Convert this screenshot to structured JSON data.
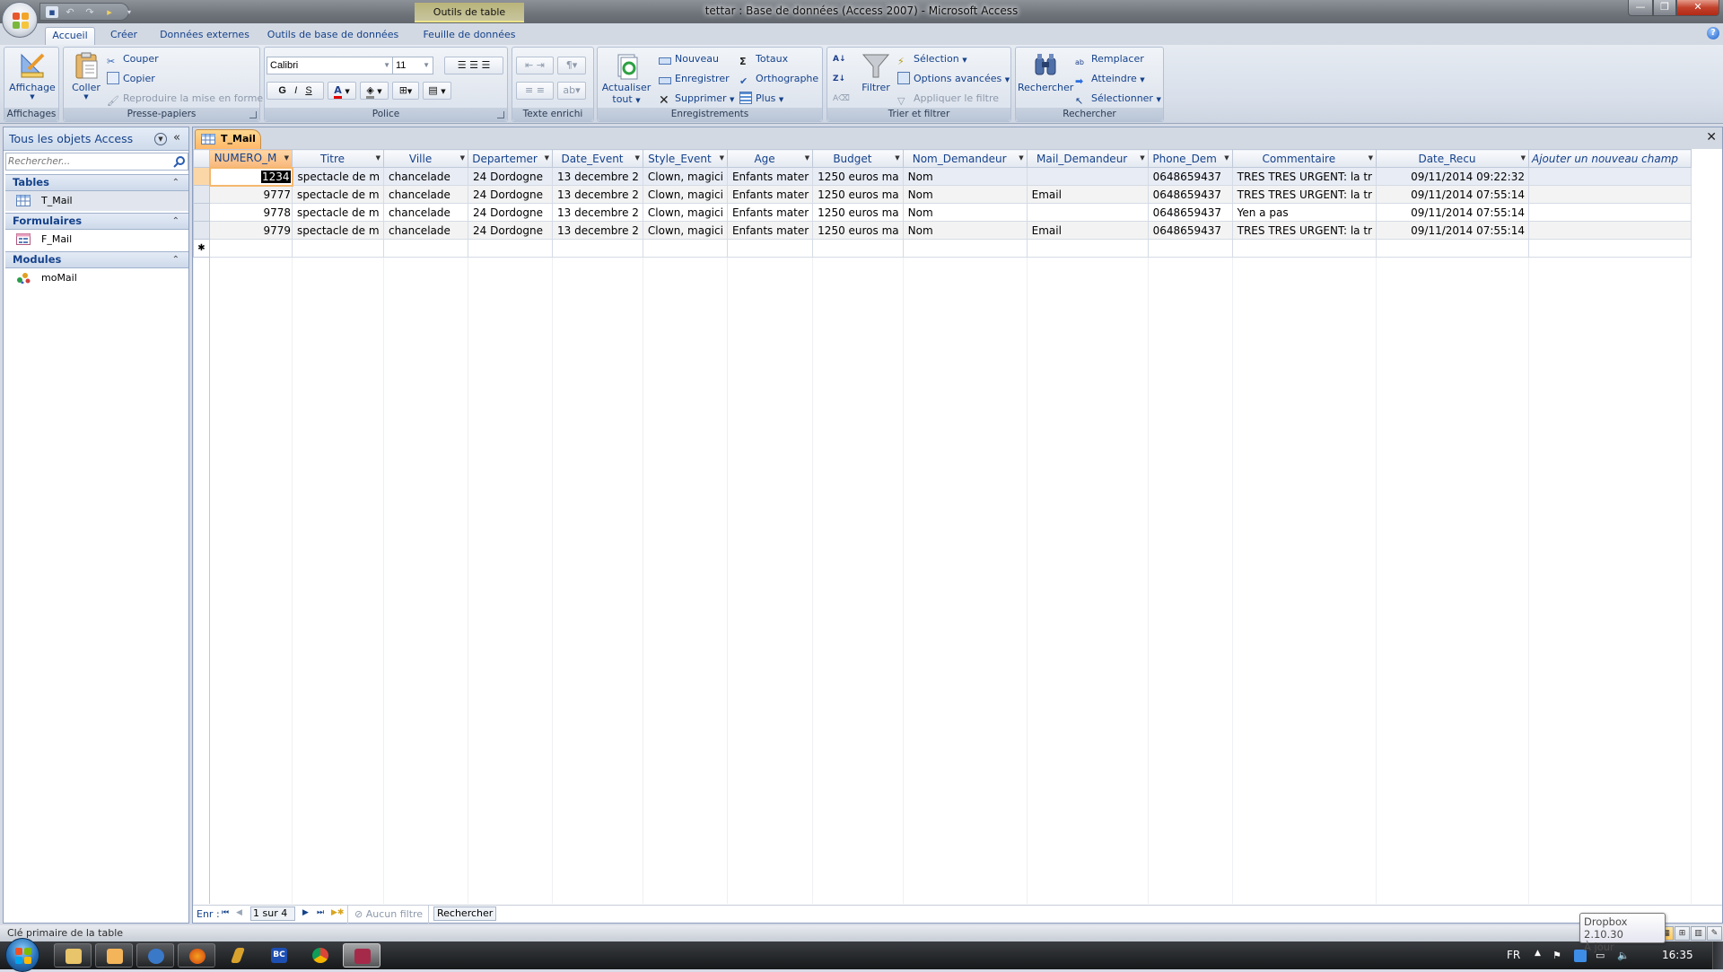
{
  "window": {
    "title": "tettar : Base de données (Access 2007) - Microsoft Access",
    "contextual_tab": "Outils de table",
    "controls": {
      "minimize": "minimize",
      "restore": "restore",
      "close": "close"
    }
  },
  "quick_access": {
    "icons": [
      "save-icon",
      "undo-icon",
      "redo-icon",
      "customize-icon"
    ]
  },
  "ribbon_tabs": [
    {
      "label": "Accueil",
      "active": true
    },
    {
      "label": "Créer"
    },
    {
      "label": "Données externes"
    },
    {
      "label": "Outils de base de données"
    },
    {
      "label": "Feuille de données"
    }
  ],
  "ribbon": {
    "affichages": {
      "group": "Affichages",
      "view": "Affichage"
    },
    "presse_papiers": {
      "group": "Presse-papiers",
      "paste": "Coller",
      "cut": "Couper",
      "copy": "Copier",
      "format_painter": "Reproduire la mise en forme"
    },
    "police": {
      "group": "Police",
      "font": "Calibri",
      "size": "11",
      "bold": "G",
      "italic": "I",
      "underline": "S",
      "font_color": "A",
      "font_color_hex": "#e00000"
    },
    "texte_enrichi": {
      "group": "Texte enrichi"
    },
    "enregistrements": {
      "group": "Enregistrements",
      "refresh": "Actualiser",
      "refresh2": "tout",
      "new": "Nouveau",
      "save": "Enregistrer",
      "delete": "Supprimer",
      "totals": "Totaux",
      "spelling": "Orthographe",
      "more": "Plus"
    },
    "trier_filtrer": {
      "group": "Trier et filtrer",
      "filter": "Filtrer",
      "selection": "Sélection",
      "advanced": "Options avancées",
      "apply": "Appliquer le filtre"
    },
    "rechercher": {
      "group": "Rechercher",
      "find": "Rechercher",
      "replace": "Remplacer",
      "goto": "Atteindre",
      "select": "Sélectionner"
    }
  },
  "nav_pane": {
    "title": "Tous les objets Access",
    "search_placeholder": "Rechercher...",
    "groups": [
      {
        "label": "Tables",
        "items": [
          {
            "label": "T_Mail",
            "icon": "table-icon",
            "selected": true
          }
        ]
      },
      {
        "label": "Formulaires",
        "items": [
          {
            "label": "F_Mail",
            "icon": "form-icon"
          }
        ]
      },
      {
        "label": "Modules",
        "items": [
          {
            "label": "moMail",
            "icon": "module-icon"
          }
        ]
      }
    ]
  },
  "document": {
    "tab_label": "T_Mail",
    "columns": [
      "NUMERO_M",
      "Titre",
      "Ville",
      "Departemer",
      "Date_Event",
      "Style_Event",
      "Age",
      "Budget",
      "Nom_Demandeur",
      "Mail_Demandeur",
      "Phone_Dem",
      "Commentaire",
      "Date_Recu"
    ],
    "add_field": "Ajouter un nouveau champ",
    "rows": [
      [
        "1234",
        "spectacle de m",
        "chancelade",
        "24 Dordogne",
        "13 decembre 2",
        "Clown, magici",
        "Enfants mater",
        "1250 euros ma",
        "Nom",
        "",
        "0648659437",
        "TRES TRES URGENT: la tr",
        "09/11/2014 09:22:32"
      ],
      [
        "9777",
        "spectacle de m",
        "chancelade",
        "24 Dordogne",
        "13 decembre 2",
        "Clown, magici",
        "Enfants mater",
        "1250 euros ma",
        "Nom",
        "Email",
        "0648659437",
        "TRES TRES URGENT: la tr",
        "09/11/2014 07:55:14"
      ],
      [
        "9778",
        "spectacle de m",
        "chancelade",
        "24 Dordogne",
        "13 decembre 2",
        "Clown, magici",
        "Enfants mater",
        "1250 euros ma",
        "Nom",
        "",
        "0648659437",
        "Yen a pas",
        "09/11/2014 07:55:14"
      ],
      [
        "9779",
        "spectacle de m",
        "chancelade",
        "24 Dordogne",
        "13 decembre 2",
        "Clown, magici",
        "Enfants mater",
        "1250 euros ma",
        "Nom",
        "Email",
        "0648659437",
        "TRES TRES URGENT: la tr",
        "09/11/2014 07:55:14"
      ]
    ],
    "new_row_marker": "✱",
    "record_nav": {
      "label": "Enr :",
      "current": "1 sur 4",
      "filter": "Aucun filtre",
      "search": "Rechercher"
    }
  },
  "status_bar": {
    "text": "Clé primaire de la table"
  },
  "tooltip": {
    "line1": "Dropbox 2.10.30",
    "line2": "À jour"
  },
  "taskbar": {
    "apps": [
      "explorer",
      "outlook",
      "thunderbird",
      "firefox",
      "winamp",
      "bc",
      "chrome",
      "access"
    ],
    "lang": "FR",
    "clock": "16:35"
  },
  "colors": {
    "accent_orange": "#f8b77b",
    "ribbon_text": "#15428b"
  }
}
